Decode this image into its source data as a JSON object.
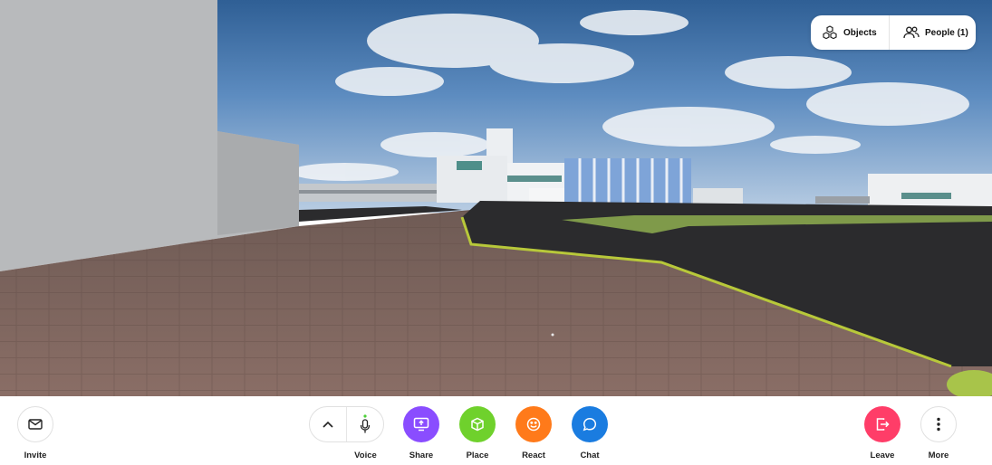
{
  "top_bar": {
    "objects_label": "Objects",
    "people_label": "People (1)",
    "objects_icon": "cubes-icon",
    "people_icon": "people-icon"
  },
  "toolbar": {
    "invite": {
      "label": "Invite",
      "icon": "mail-icon"
    },
    "expand": {
      "icon": "chevron-up-icon"
    },
    "voice": {
      "label": "Voice",
      "icon": "microphone-icon",
      "indicator_color": "#4cd137"
    },
    "share": {
      "label": "Share",
      "icon": "screen-share-icon",
      "color": "#8a4dff"
    },
    "place": {
      "label": "Place",
      "icon": "cube-icon",
      "color": "#6fd12c"
    },
    "react": {
      "label": "React",
      "icon": "smiley-icon",
      "color": "#ff7a1a"
    },
    "chat": {
      "label": "Chat",
      "icon": "chat-bubble-icon",
      "color": "#1a7ce0"
    },
    "leave": {
      "label": "Leave",
      "icon": "exit-icon",
      "color": "#ff3d68"
    },
    "more": {
      "label": "More",
      "icon": "more-vertical-icon"
    }
  }
}
